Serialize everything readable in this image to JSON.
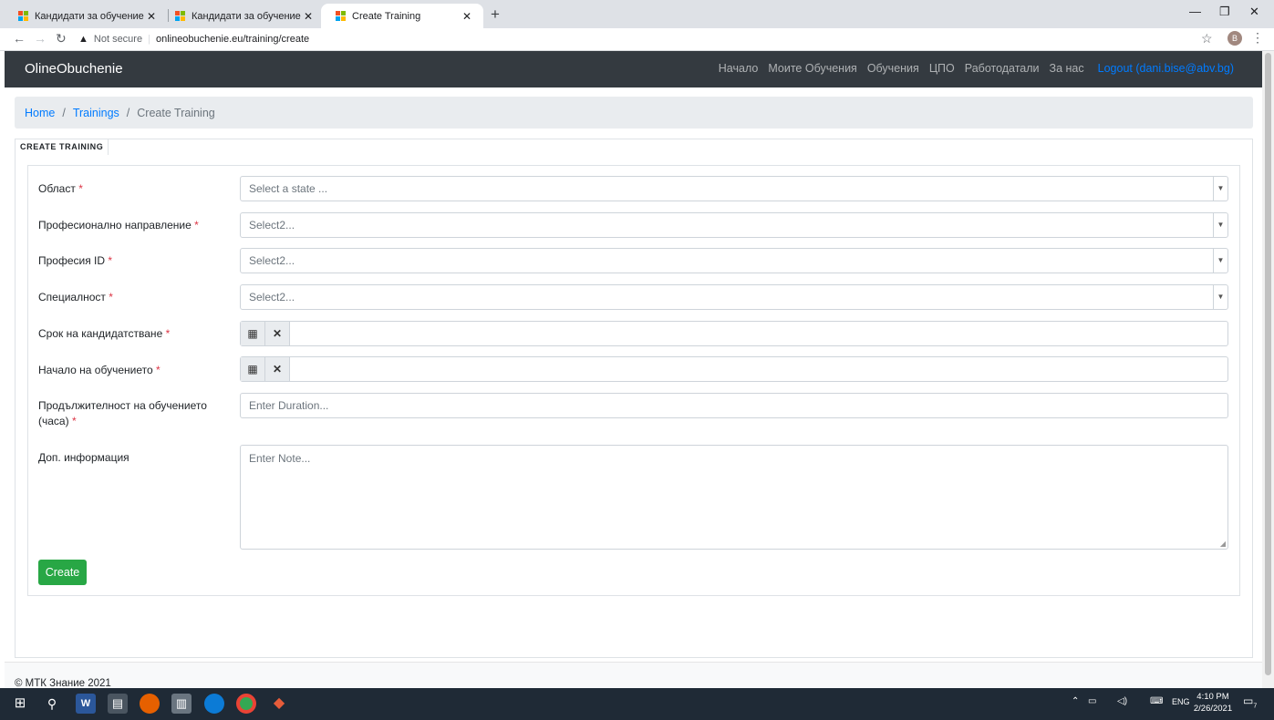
{
  "browser": {
    "tabs": [
      {
        "label": "Кандидати за обучение",
        "active": false
      },
      {
        "label": "Кандидати за обучение",
        "active": false
      },
      {
        "label": "Create Training",
        "active": true
      }
    ],
    "security_label": "Not secure",
    "url": "onlineobuchenie.eu/training/create",
    "profile_initial": "B"
  },
  "navbar": {
    "brand": "OlineObuchenie",
    "links": [
      "Начало",
      "Моите Обучения",
      "Обучения",
      "ЦПО",
      "Работодатали",
      "За нас"
    ],
    "logout": "Logout (dani.bise@abv.bg)"
  },
  "breadcrumb": {
    "home": "Home",
    "trainings": "Trainings",
    "current": "Create Training",
    "separator": "/"
  },
  "form": {
    "header": "CREATE TRAINING",
    "required_mark": "*",
    "region": {
      "label": "Област",
      "placeholder": "Select a state ..."
    },
    "direction": {
      "label": "Професионално направление",
      "placeholder": "Select2..."
    },
    "profession": {
      "label": "Професия ID",
      "placeholder": "Select2..."
    },
    "specialty": {
      "label": "Специалност",
      "placeholder": "Select2..."
    },
    "deadline": {
      "label": "Срок на кандидатстване"
    },
    "start": {
      "label": "Начало на обучението"
    },
    "duration": {
      "label": "Продължителност на обучението (часа)",
      "placeholder": "Enter Duration..."
    },
    "note": {
      "label": "Доп. информация",
      "placeholder": "Enter Note..."
    },
    "submit": "Create"
  },
  "footer": {
    "text": "© МТК Знание 2021"
  },
  "taskbar": {
    "lang": "ENG",
    "time": "4:10 PM",
    "date": "2/26/2021",
    "notification_count": "7"
  },
  "colors": {
    "navbar_bg": "#343a40",
    "link": "#007bff",
    "required": "#dc3545",
    "create_button": "#28a745"
  }
}
